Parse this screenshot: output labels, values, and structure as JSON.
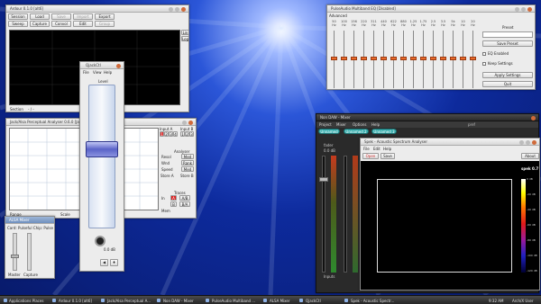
{
  "desktop": {
    "accent": "#2b56d8"
  },
  "ardour": {
    "title": "Ardour 0.1.0 [alt6]",
    "menu": [
      [
        "Session",
        "Load",
        "Save",
        "Import",
        "Export"
      ],
      [
        "Sweep",
        "Capture",
        "Convol",
        "Edit",
        "Group"
      ]
    ],
    "side": [
      "Lin",
      "Log"
    ],
    "section_label": "Section",
    "section_value": "- / -"
  },
  "jaaa": {
    "title": "Jack/Alsa Perceptual Analyser 0.6.0  [Jack]",
    "input_a": "Input A",
    "input_b": "Input B",
    "channels": [
      "1",
      "2",
      "3",
      "4"
    ],
    "analyser_label": "Analyser",
    "opts": [
      {
        "k": "Resol",
        "v": "Med"
      },
      {
        "k": "Wnd",
        "v": "Rank"
      },
      {
        "k": "Speed",
        "v": "Med"
      }
    ],
    "store_a": "Store A",
    "store_b": "Store B",
    "traces": "Traces",
    "trace_rows": [
      "In",
      "A",
      "B",
      "Mem"
    ],
    "trace_vals": [
      "A/B",
      "A-B",
      "B/A",
      "B-A"
    ],
    "bottom": [
      "Range",
      "Scale",
      "Video"
    ]
  },
  "alsamixer": {
    "title": "ALSA Mixer",
    "card": "Card: Pulseful Chip: Pulse",
    "labels": [
      "Master",
      "Capture"
    ]
  },
  "qsynth": {
    "title": "QjackCtl",
    "menu": [
      "File",
      "View",
      "Help"
    ],
    "top_label": "Level",
    "value_label": "0.0 dB"
  },
  "eq": {
    "title": "PulseAudio Multiband EQ [Disabled]",
    "section": "Advanced",
    "freqs": [
      "50",
      "100",
      "156",
      "220",
      "311",
      "440",
      "622",
      "880",
      "1.25",
      "1.75",
      "2.5",
      "3.5",
      "5k",
      "10",
      "20"
    ],
    "unit": "Hz",
    "db": "0.0 dB",
    "preset_label": "Preset",
    "save_preset": "Save Preset",
    "enabled": "EQ Enabled",
    "keep": "Keep Settings",
    "apply": "Apply Settings",
    "quit": "Quit"
  },
  "nondaw": {
    "title": "Non DAW - Mixer",
    "menu": [
      "Project",
      "Mixer",
      "Options",
      "Help"
    ],
    "tag": "pref",
    "strips": [
      "Unnamed",
      "Unnamed 2",
      "Unnamed 3"
    ],
    "fader": "fader",
    "gain": "0.0 dB",
    "inputs": "Inputs"
  },
  "spek": {
    "title": "Spek - Acoustic Spectrum Analyser",
    "menu": [
      "File",
      "Edit",
      "Help"
    ],
    "open": "Open",
    "save": "Save",
    "about": "About",
    "logo": "spek 0.7",
    "scale": [
      "0 dB",
      "-20 dB",
      "-40 dB",
      "-60 dB",
      "-80 dB",
      "-100 dB",
      "-120 dB"
    ]
  },
  "taskbar": {
    "apps": "Applications Places",
    "tasks": [
      "Ardour 0.1.0 [alt6]",
      "Jack/Alsa Perceptual A...",
      "Non DAW - Mixer",
      "PulseAudio Multiband ...",
      "ALSA Mixer",
      "QjackCtl",
      "Spek - Acoustic Spectr..."
    ],
    "time": "9:32 AM",
    "user": "Arch/X User"
  }
}
